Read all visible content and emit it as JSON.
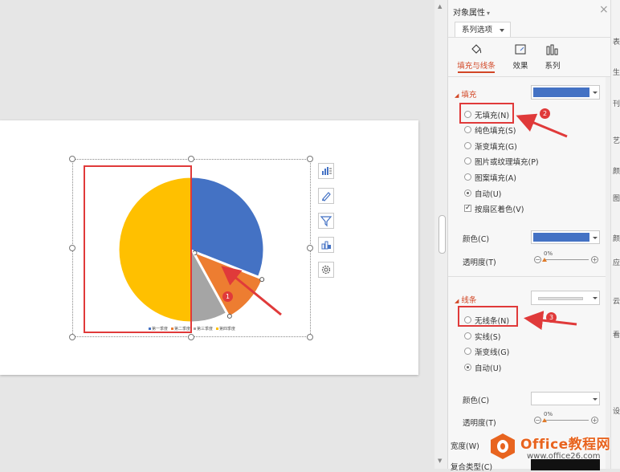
{
  "panel": {
    "title": "对象属性",
    "title_arrow": "▾",
    "close": "×",
    "series_dropdown": "系列选项",
    "tabs": [
      {
        "label": "填充与线条",
        "icon": "fill-bucket-icon",
        "active": true
      },
      {
        "label": "效果",
        "icon": "effects-icon",
        "active": false
      },
      {
        "label": "系列",
        "icon": "series-bars-icon",
        "active": false
      }
    ],
    "fill": {
      "section": "填充",
      "color_hex": "#4472c4",
      "options": [
        "无填充(N)",
        "纯色填充(S)",
        "渐变填充(G)",
        "图片或纹理填充(P)",
        "图案填充(A)",
        "自动(U)"
      ],
      "selected": "自动(U)",
      "vary_by_point": "按扇区着色(V)",
      "vary_checked": true,
      "color_label": "颜色(C)",
      "color_value_hex": "#4472c4",
      "transparency_label": "透明度(T)",
      "transparency_value": "0%"
    },
    "line": {
      "section": "线条",
      "options": [
        "无线条(N)",
        "实线(S)",
        "渐变线(G)",
        "自动(U)"
      ],
      "selected": "自动(U)",
      "color_label": "颜色(C)",
      "transparency_label": "透明度(T)",
      "transparency_value": "0%",
      "width_label": "宽度(W)",
      "compound_label": "复合类型(C)"
    }
  },
  "edge_chars": [
    "表",
    "生",
    "刊",
    "艺",
    "颜",
    "图",
    "颜",
    "应",
    "云",
    "看",
    "设"
  ],
  "annotations": [
    "1",
    "2",
    "3"
  ],
  "chart_toolbar": [
    "chart-elements-icon",
    "chart-styles-icon",
    "chart-filter-icon",
    "chart-layout-icon",
    "chart-settings-icon"
  ],
  "chart_data": {
    "type": "pie",
    "slices": [
      {
        "label": "第一季度",
        "value": 31,
        "color": "#4472c4"
      },
      {
        "label": "第二季度",
        "value": 11,
        "color": "#ed7d31"
      },
      {
        "label": "第三季度",
        "value": 8,
        "color": "#a5a5a5"
      },
      {
        "label": "第四季度",
        "value": 50,
        "color": "#ffc000"
      }
    ],
    "legend": [
      "第一季度",
      "第二季度",
      "第三季度",
      "第四季度"
    ],
    "legend_position": "bottom"
  },
  "watermark": {
    "brand": "Office教程网",
    "url": "www.office26.com"
  }
}
